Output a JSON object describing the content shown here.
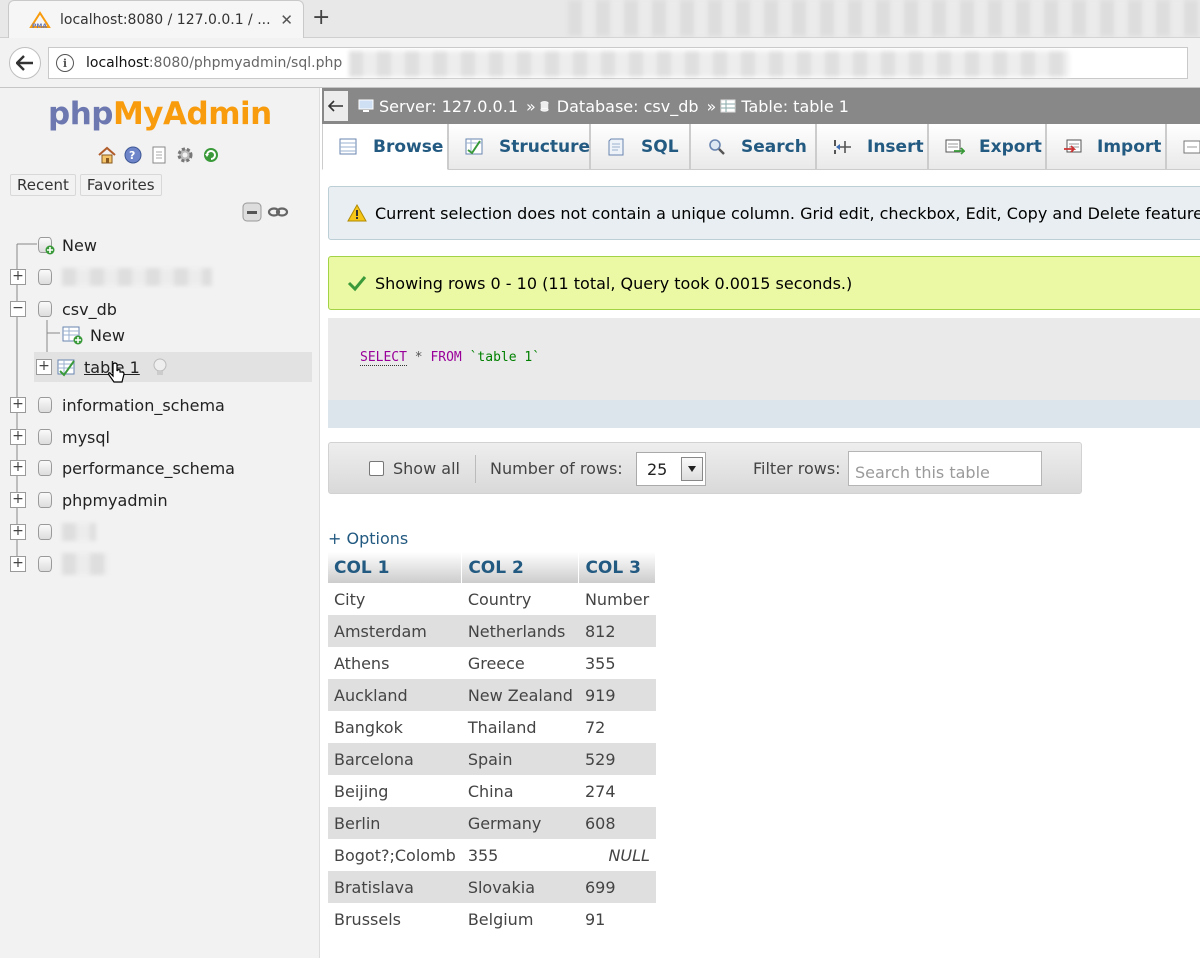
{
  "browser": {
    "tab_title": "localhost:8080 / 127.0.0.1 / ...",
    "tab_close": "✕",
    "new_tab": "+",
    "url_host": "localhost",
    "url_rest": ":8080/phpmyadmin/sql.php"
  },
  "nav": {
    "logo": {
      "php": "php",
      "my": "My",
      "admin": "Admin"
    },
    "icons": [
      "home-icon",
      "logout-icon",
      "docs-icon",
      "settings-icon",
      "reload-icon"
    ],
    "tabs": [
      "Recent",
      "Favorites"
    ],
    "tree": {
      "new": "New",
      "csv_db": "csv_db",
      "csv_db_new": "New",
      "table1": "table 1",
      "information_schema": "information_schema",
      "mysql": "mysql",
      "performance_schema": "performance_schema",
      "phpmyadmin": "phpmyadmin"
    }
  },
  "breadcrumb": {
    "server": "Server: 127.0.0.1",
    "database": "Database: csv_db",
    "table": "Table: table 1",
    "sep": "»"
  },
  "tabs": [
    "Browse",
    "Structure",
    "SQL",
    "Search",
    "Insert",
    "Export",
    "Import"
  ],
  "active_tab": "Browse",
  "notice": "Current selection does not contain a unique column. Grid edit, checkbox, Edit, Copy and Delete features are not available.",
  "success": "Showing rows 0 - 10 (11 total, Query took 0.0015 seconds.)",
  "sql": {
    "select": "SELECT",
    "star": "*",
    "from": "FROM",
    "table": "`table 1`"
  },
  "controls": {
    "show_all": "Show all",
    "number_of_rows_label": "Number of rows:",
    "number_of_rows_value": "25",
    "filter_label": "Filter rows:",
    "filter_placeholder": "Search this table"
  },
  "options_link": "+ Options",
  "table": {
    "headers": [
      "COL 1",
      "COL 2",
      "COL 3"
    ],
    "rows": [
      [
        "City",
        "Country",
        "Number"
      ],
      [
        "Amsterdam",
        "Netherlands",
        "812"
      ],
      [
        "Athens",
        "Greece",
        "355"
      ],
      [
        "Auckland",
        "New Zealand",
        "919"
      ],
      [
        "Bangkok",
        "Thailand",
        "72"
      ],
      [
        "Barcelona",
        "Spain",
        "529"
      ],
      [
        "Beijing",
        "China",
        "274"
      ],
      [
        "Berlin",
        "Germany",
        "608"
      ],
      [
        "Bogot?;Colomb",
        "355",
        "NULL"
      ],
      [
        "Bratislava",
        "Slovakia",
        "699"
      ],
      [
        "Brussels",
        "Belgium",
        "91"
      ]
    ]
  },
  "colors": {
    "link": "#235a81",
    "logo_php": "#6c78af",
    "logo_myadmin": "#f89c0e",
    "success_bg": "#ebf8a4",
    "notice_bg": "#e8eef1",
    "topbar": "#888888"
  }
}
